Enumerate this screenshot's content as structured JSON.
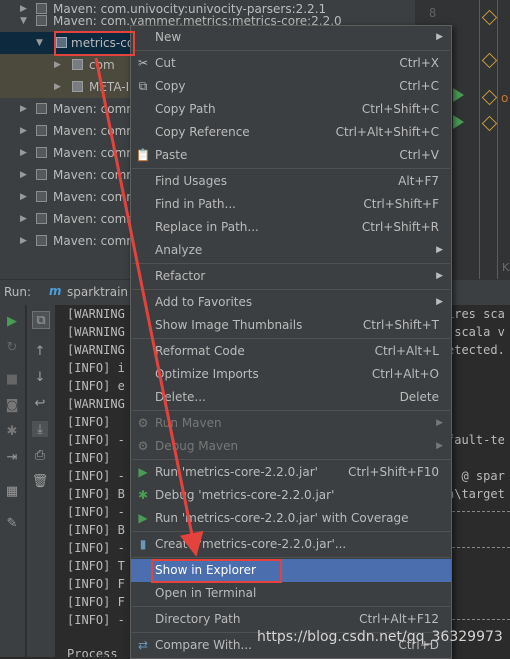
{
  "tree": {
    "rows": [
      {
        "label": "Maven: com.univocity:univocity-parsers:2.2.1",
        "kind": "lib"
      },
      {
        "label": "Maven: com.yammer.metrics:metrics-core:2.2.0",
        "kind": "lib"
      },
      {
        "label": "metrics-co",
        "kind": "jar"
      },
      {
        "label": "com",
        "kind": "folder"
      },
      {
        "label": "META-IN",
        "kind": "folder"
      },
      {
        "label": "Maven: comm",
        "kind": "lib"
      },
      {
        "label": "Maven: comm",
        "kind": "lib"
      },
      {
        "label": "Maven: comm",
        "kind": "lib"
      },
      {
        "label": "Maven: comm",
        "kind": "lib"
      },
      {
        "label": "Maven: comm",
        "kind": "lib"
      },
      {
        "label": "Maven: comm",
        "kind": "lib"
      },
      {
        "label": "Maven: comm",
        "kind": "lib"
      }
    ]
  },
  "editor": {
    "line_number": "8",
    "fold_text": "o",
    "tab_fragment": "Ka"
  },
  "run_bar": {
    "label": "Run:",
    "tab_name": "sparktrain [",
    "logo": "m"
  },
  "console": {
    "lines": [
      "[WARNING",
      "[WARNING",
      "[WARNING",
      "[INFO] i",
      "[INFO] e",
      "[WARNING",
      "[INFO]",
      "[INFO] -",
      "[INFO]",
      "[INFO] -",
      "[INFO] B",
      "[INFO] -",
      "[INFO] B",
      "[INFO] -",
      "[INFO] T",
      "[INFO] F",
      "[INFO] F",
      "[INFO] -"
    ],
    "right_fragments": [
      "ires sca",
      " scala v",
      "etected.",
      "fault-te",
      ") @ spar",
      "n\\target"
    ],
    "bottom_text": "Process"
  },
  "menu": {
    "items": [
      {
        "label": "New",
        "shortcut": "",
        "submenu": true,
        "icon": ""
      },
      {
        "separator": true
      },
      {
        "label": "Cut",
        "shortcut": "Ctrl+X",
        "icon": "scissors-icon"
      },
      {
        "label": "Copy",
        "shortcut": "Ctrl+C",
        "icon": "copy-icon"
      },
      {
        "label": "Copy Path",
        "shortcut": "Ctrl+Shift+C",
        "icon": ""
      },
      {
        "label": "Copy Reference",
        "shortcut": "Ctrl+Alt+Shift+C",
        "icon": ""
      },
      {
        "label": "Paste",
        "shortcut": "Ctrl+V",
        "icon": "clipboard-icon"
      },
      {
        "separator": true
      },
      {
        "label": "Find Usages",
        "shortcut": "Alt+F7",
        "icon": ""
      },
      {
        "label": "Find in Path...",
        "shortcut": "Ctrl+Shift+F",
        "icon": ""
      },
      {
        "label": "Replace in Path...",
        "shortcut": "Ctrl+Shift+R",
        "icon": ""
      },
      {
        "label": "Analyze",
        "shortcut": "",
        "submenu": true,
        "icon": ""
      },
      {
        "separator": true
      },
      {
        "label": "Refactor",
        "shortcut": "",
        "submenu": true,
        "icon": ""
      },
      {
        "separator": true
      },
      {
        "label": "Add to Favorites",
        "shortcut": "",
        "submenu": true,
        "icon": ""
      },
      {
        "label": "Show Image Thumbnails",
        "shortcut": "Ctrl+Shift+T",
        "icon": ""
      },
      {
        "separator": true
      },
      {
        "label": "Reformat Code",
        "shortcut": "Ctrl+Alt+L",
        "icon": ""
      },
      {
        "label": "Optimize Imports",
        "shortcut": "Ctrl+Alt+O",
        "icon": ""
      },
      {
        "label": "Delete...",
        "shortcut": "Delete",
        "icon": ""
      },
      {
        "separator": true
      },
      {
        "label": "Run Maven",
        "shortcut": "",
        "submenu": true,
        "icon": "gear-icon",
        "disabled": true
      },
      {
        "label": "Debug Maven",
        "shortcut": "",
        "submenu": true,
        "icon": "gear-icon",
        "disabled": true
      },
      {
        "separator": true
      },
      {
        "label": "Run 'metrics-core-2.2.0.jar'",
        "shortcut": "Ctrl+Shift+F10",
        "icon": "run-icon"
      },
      {
        "label": "Debug 'metrics-core-2.2.0.jar'",
        "shortcut": "",
        "icon": "debug-icon"
      },
      {
        "label": "Run 'metrics-core-2.2.0.jar' with Coverage",
        "shortcut": "",
        "icon": "coverage-icon"
      },
      {
        "separator": true
      },
      {
        "label": "Create 'metrics-core-2.2.0.jar'...",
        "shortcut": "",
        "icon": "create-config-icon"
      },
      {
        "separator": true
      },
      {
        "label": "Show in Explorer",
        "shortcut": "",
        "icon": "",
        "highlighted": true
      },
      {
        "label": "Open in Terminal",
        "shortcut": "",
        "icon": ""
      },
      {
        "separator": true
      },
      {
        "label": "Directory Path",
        "shortcut": "Ctrl+Alt+F12",
        "icon": ""
      },
      {
        "separator": true
      },
      {
        "label": "Compare With...",
        "shortcut": "Ctrl+D",
        "icon": "compare-icon"
      }
    ]
  },
  "watermark": "https://blog.csdn.net/qq_36329973",
  "colors": {
    "annotation_red": "#e4423c",
    "menu_highlight": "#4b6eaf",
    "run_green": "#499c54"
  }
}
